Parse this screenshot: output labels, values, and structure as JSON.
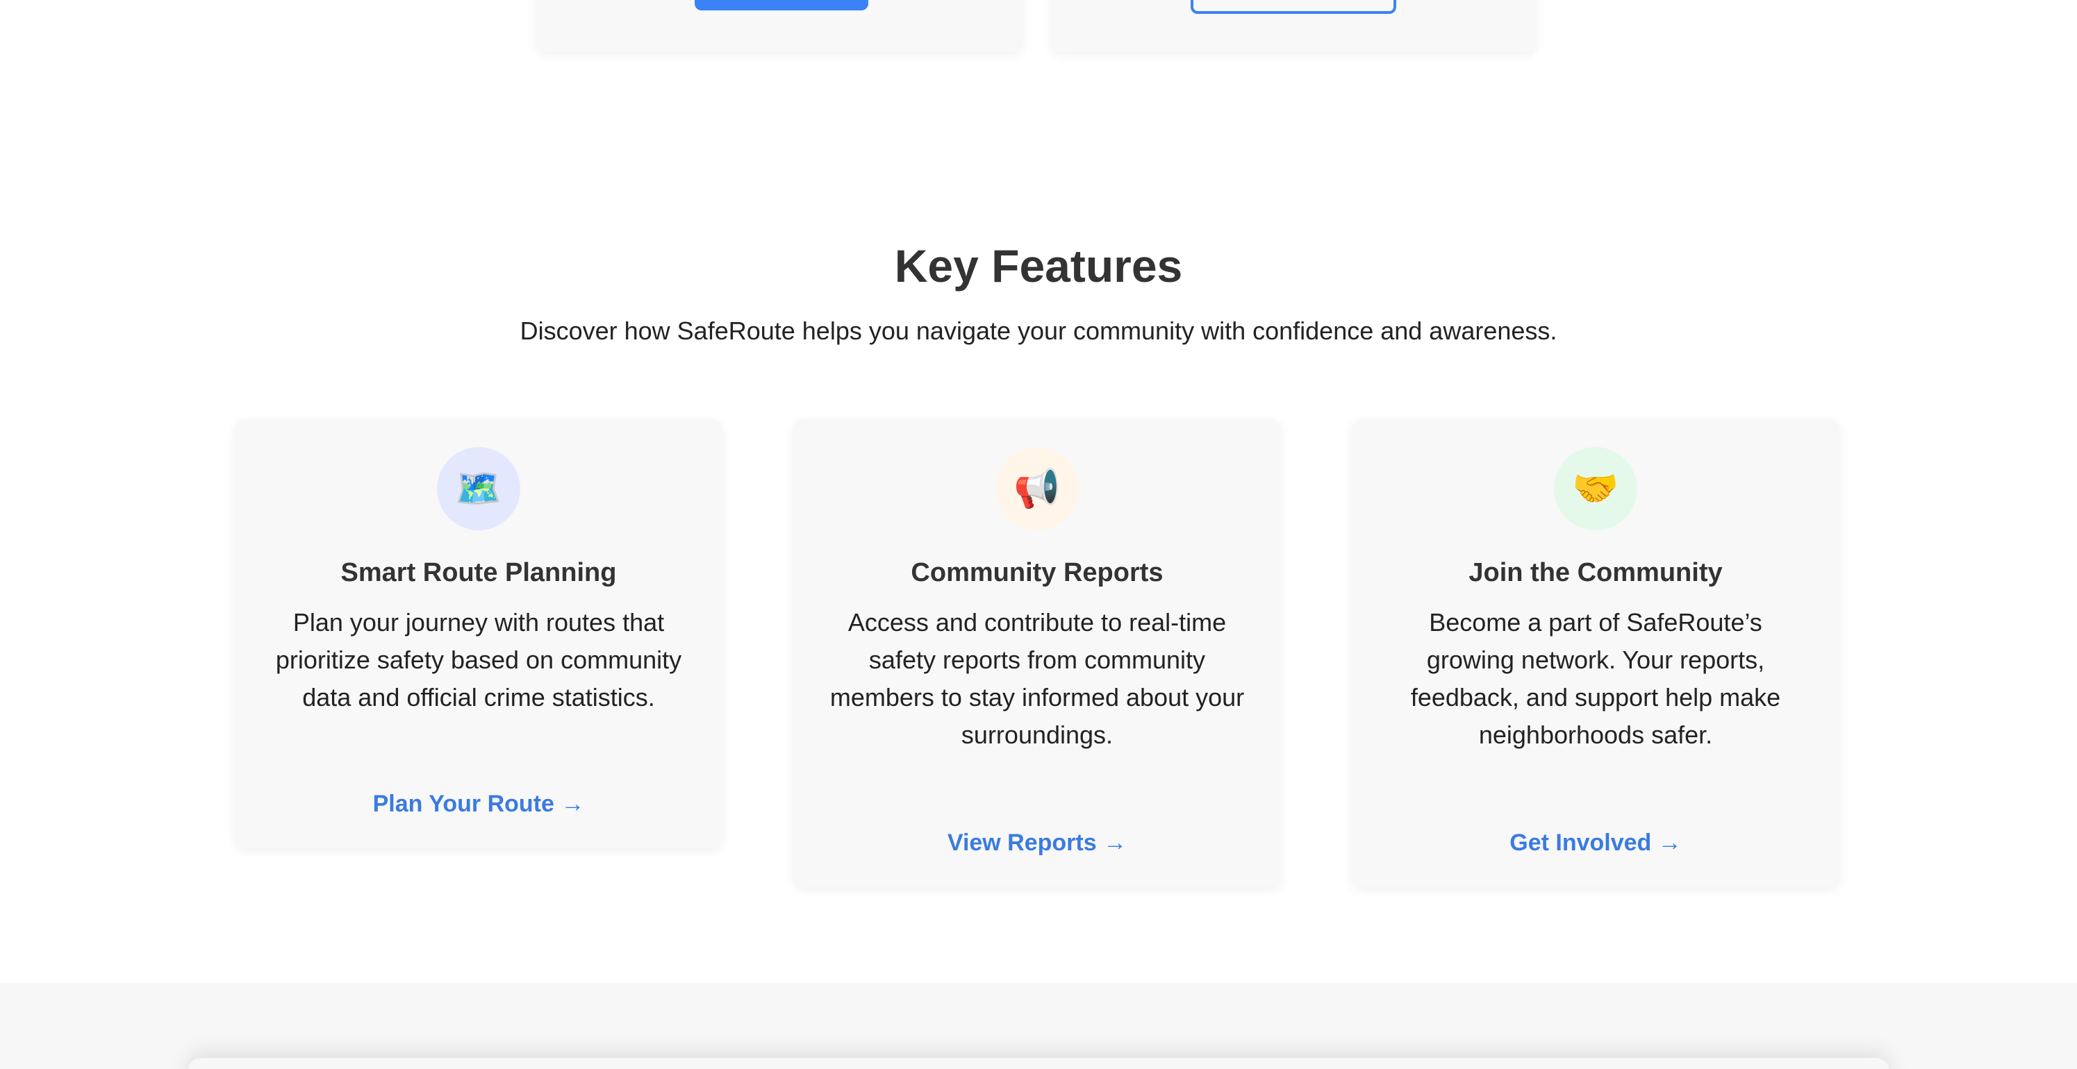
{
  "features_section": {
    "title": "Key Features",
    "subtitle": "Discover how SafeRoute helps you navigate your community with confidence and awareness."
  },
  "features": [
    {
      "icon": "🗺️",
      "icon_name": "map-icon",
      "title": "Smart Route Planning",
      "description": "Plan your journey with routes that prioritize safety based on community data and official crime statistics.",
      "link": "Plan Your Route →"
    },
    {
      "icon": "📢",
      "icon_name": "megaphone-icon",
      "title": "Community Reports",
      "description": "Access and contribute to real-time safety reports from community members to stay informed about your surroundings.",
      "link": "View Reports →"
    },
    {
      "icon": "🤝",
      "icon_name": "handshake-icon",
      "title": "Join the Community",
      "description": "Become a part of SafeRoute’s growing network. Your reports, feedback, and support help make neighborhoods safer.",
      "link": "Get Involved →"
    }
  ],
  "colors": {
    "accent": "#3b82f6",
    "link": "#3a7be0",
    "card_bg": "#f8f8f8",
    "heading": "#333333"
  }
}
